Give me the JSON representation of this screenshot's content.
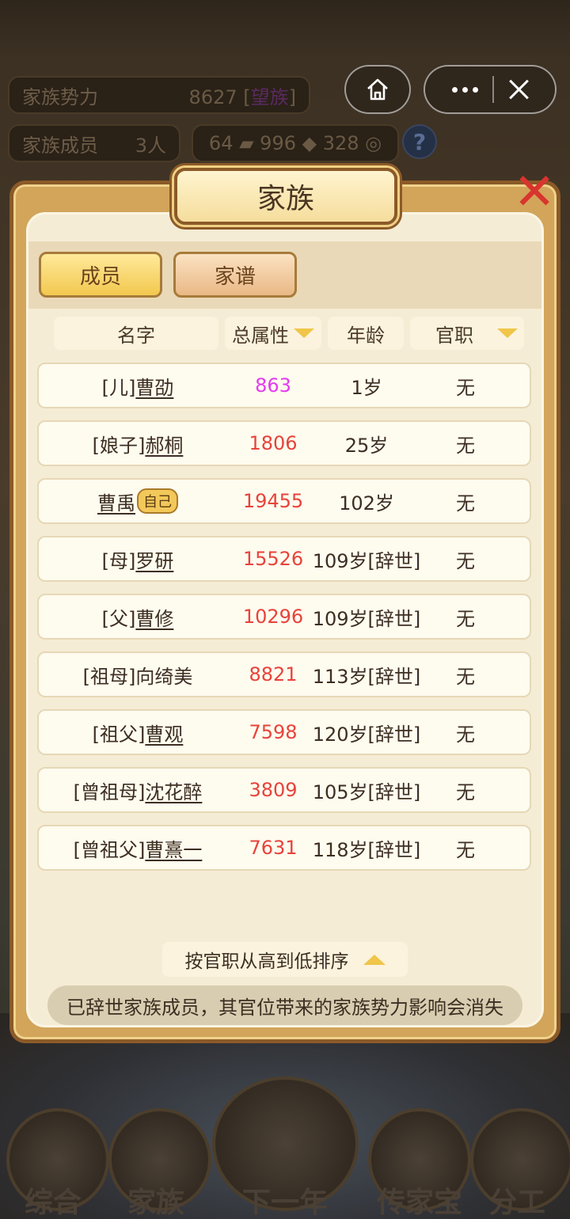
{
  "capsule": {
    "home": "home-icon",
    "more": "more-icon",
    "close": "close-icon"
  },
  "background": {
    "power_label": "家族势力",
    "power_value": "8627 [",
    "power_rank": "望族",
    "power_close": "]",
    "members_label": "家族成员",
    "members_value": "3人",
    "resources": "64 ▰ 996 ◆ 328 ◎",
    "help": "?",
    "nav": [
      "综合",
      "家族",
      "下一年",
      "传家宝",
      "分工"
    ]
  },
  "dialog": {
    "title": "家族",
    "tabs": {
      "members": "成员",
      "genealogy": "家谱"
    },
    "columns": {
      "name": "名字",
      "attr": "总属性",
      "age": "年龄",
      "post": "官职"
    },
    "rows": [
      {
        "prefix": "[儿]",
        "name": "曹劭",
        "badge": "",
        "attr": "863",
        "age": "1岁",
        "post": "无"
      },
      {
        "prefix": "[娘子]",
        "name": "郝桐",
        "badge": "",
        "attr": "1806",
        "age": "25岁",
        "post": "无"
      },
      {
        "prefix": "",
        "name": "曹禹",
        "badge": "自己",
        "attr": "19455",
        "age": "102岁",
        "post": "无"
      },
      {
        "prefix": "[母]",
        "name": "罗研",
        "badge": "",
        "attr": "15526",
        "age": "109岁[辞世]",
        "post": "无"
      },
      {
        "prefix": "[父]",
        "name": "曹修",
        "badge": "",
        "attr": "10296",
        "age": "109岁[辞世]",
        "post": "无"
      },
      {
        "prefix": "[祖母]",
        "name": "向绮美",
        "badge": "",
        "attr": "8821",
        "age": "113岁[辞世]",
        "post": "无"
      },
      {
        "prefix": "[祖父]",
        "name": "曹观",
        "badge": "",
        "attr": "7598",
        "age": "120岁[辞世]",
        "post": "无"
      },
      {
        "prefix": "[曾祖母]",
        "name": "沈花醉",
        "badge": "",
        "attr": "3809",
        "age": "105岁[辞世]",
        "post": "无"
      },
      {
        "prefix": "[曾祖父]",
        "name": "曹熹一",
        "badge": "",
        "attr": "7631",
        "age": "118岁[辞世]",
        "post": "无"
      }
    ],
    "sort_label": "按官职从高到低排序",
    "notice": "已辞世家族成员，其官位带来的家族势力影响会消失"
  },
  "colors": {
    "attr_red": "#e8433a",
    "attr_magenta": "#e23bf0",
    "tab_active": "#f2c84f",
    "frame": "#8b5a28"
  }
}
